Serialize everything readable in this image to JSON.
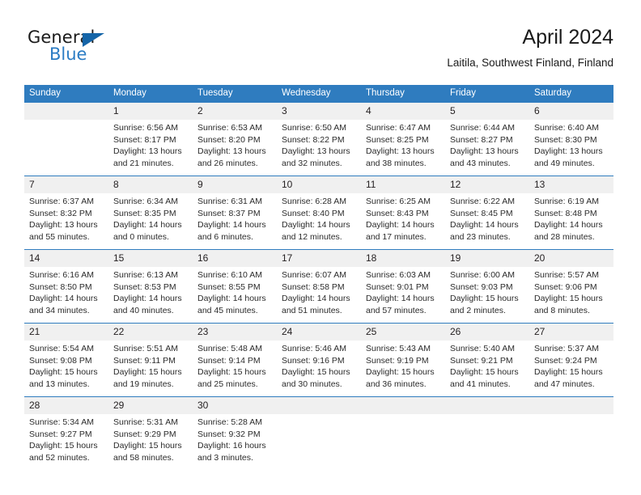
{
  "brand": {
    "name_part1": "General",
    "name_part2": "Blue",
    "triangle_color": "#1565a8",
    "blue_color": "#2b7cc4"
  },
  "header": {
    "title": "April 2024",
    "subtitle": "Laitila, Southwest Finland, Finland"
  },
  "theme": {
    "header_bg": "#2f7cbf",
    "daynum_bg": "#f0f0f0",
    "separator": "#2f7cbf",
    "text": "#231f20"
  },
  "weekday_headers": [
    "Sunday",
    "Monday",
    "Tuesday",
    "Wednesday",
    "Thursday",
    "Friday",
    "Saturday"
  ],
  "labels": {
    "sunrise": "Sunrise:",
    "sunset": "Sunset:",
    "daylight": "Daylight:"
  },
  "weeks": [
    {
      "days": [
        {
          "num": "",
          "empty": true,
          "line1": "",
          "line2": "",
          "line3": "",
          "line4": ""
        },
        {
          "num": "1",
          "empty": false,
          "line1": "Sunrise: 6:56 AM",
          "line2": "Sunset: 8:17 PM",
          "line3": "Daylight: 13 hours",
          "line4": "and 21 minutes."
        },
        {
          "num": "2",
          "empty": false,
          "line1": "Sunrise: 6:53 AM",
          "line2": "Sunset: 8:20 PM",
          "line3": "Daylight: 13 hours",
          "line4": "and 26 minutes."
        },
        {
          "num": "3",
          "empty": false,
          "line1": "Sunrise: 6:50 AM",
          "line2": "Sunset: 8:22 PM",
          "line3": "Daylight: 13 hours",
          "line4": "and 32 minutes."
        },
        {
          "num": "4",
          "empty": false,
          "line1": "Sunrise: 6:47 AM",
          "line2": "Sunset: 8:25 PM",
          "line3": "Daylight: 13 hours",
          "line4": "and 38 minutes."
        },
        {
          "num": "5",
          "empty": false,
          "line1": "Sunrise: 6:44 AM",
          "line2": "Sunset: 8:27 PM",
          "line3": "Daylight: 13 hours",
          "line4": "and 43 minutes."
        },
        {
          "num": "6",
          "empty": false,
          "line1": "Sunrise: 6:40 AM",
          "line2": "Sunset: 8:30 PM",
          "line3": "Daylight: 13 hours",
          "line4": "and 49 minutes."
        }
      ]
    },
    {
      "days": [
        {
          "num": "7",
          "empty": false,
          "line1": "Sunrise: 6:37 AM",
          "line2": "Sunset: 8:32 PM",
          "line3": "Daylight: 13 hours",
          "line4": "and 55 minutes."
        },
        {
          "num": "8",
          "empty": false,
          "line1": "Sunrise: 6:34 AM",
          "line2": "Sunset: 8:35 PM",
          "line3": "Daylight: 14 hours",
          "line4": "and 0 minutes."
        },
        {
          "num": "9",
          "empty": false,
          "line1": "Sunrise: 6:31 AM",
          "line2": "Sunset: 8:37 PM",
          "line3": "Daylight: 14 hours",
          "line4": "and 6 minutes."
        },
        {
          "num": "10",
          "empty": false,
          "line1": "Sunrise: 6:28 AM",
          "line2": "Sunset: 8:40 PM",
          "line3": "Daylight: 14 hours",
          "line4": "and 12 minutes."
        },
        {
          "num": "11",
          "empty": false,
          "line1": "Sunrise: 6:25 AM",
          "line2": "Sunset: 8:43 PM",
          "line3": "Daylight: 14 hours",
          "line4": "and 17 minutes."
        },
        {
          "num": "12",
          "empty": false,
          "line1": "Sunrise: 6:22 AM",
          "line2": "Sunset: 8:45 PM",
          "line3": "Daylight: 14 hours",
          "line4": "and 23 minutes."
        },
        {
          "num": "13",
          "empty": false,
          "line1": "Sunrise: 6:19 AM",
          "line2": "Sunset: 8:48 PM",
          "line3": "Daylight: 14 hours",
          "line4": "and 28 minutes."
        }
      ]
    },
    {
      "days": [
        {
          "num": "14",
          "empty": false,
          "line1": "Sunrise: 6:16 AM",
          "line2": "Sunset: 8:50 PM",
          "line3": "Daylight: 14 hours",
          "line4": "and 34 minutes."
        },
        {
          "num": "15",
          "empty": false,
          "line1": "Sunrise: 6:13 AM",
          "line2": "Sunset: 8:53 PM",
          "line3": "Daylight: 14 hours",
          "line4": "and 40 minutes."
        },
        {
          "num": "16",
          "empty": false,
          "line1": "Sunrise: 6:10 AM",
          "line2": "Sunset: 8:55 PM",
          "line3": "Daylight: 14 hours",
          "line4": "and 45 minutes."
        },
        {
          "num": "17",
          "empty": false,
          "line1": "Sunrise: 6:07 AM",
          "line2": "Sunset: 8:58 PM",
          "line3": "Daylight: 14 hours",
          "line4": "and 51 minutes."
        },
        {
          "num": "18",
          "empty": false,
          "line1": "Sunrise: 6:03 AM",
          "line2": "Sunset: 9:01 PM",
          "line3": "Daylight: 14 hours",
          "line4": "and 57 minutes."
        },
        {
          "num": "19",
          "empty": false,
          "line1": "Sunrise: 6:00 AM",
          "line2": "Sunset: 9:03 PM",
          "line3": "Daylight: 15 hours",
          "line4": "and 2 minutes."
        },
        {
          "num": "20",
          "empty": false,
          "line1": "Sunrise: 5:57 AM",
          "line2": "Sunset: 9:06 PM",
          "line3": "Daylight: 15 hours",
          "line4": "and 8 minutes."
        }
      ]
    },
    {
      "days": [
        {
          "num": "21",
          "empty": false,
          "line1": "Sunrise: 5:54 AM",
          "line2": "Sunset: 9:08 PM",
          "line3": "Daylight: 15 hours",
          "line4": "and 13 minutes."
        },
        {
          "num": "22",
          "empty": false,
          "line1": "Sunrise: 5:51 AM",
          "line2": "Sunset: 9:11 PM",
          "line3": "Daylight: 15 hours",
          "line4": "and 19 minutes."
        },
        {
          "num": "23",
          "empty": false,
          "line1": "Sunrise: 5:48 AM",
          "line2": "Sunset: 9:14 PM",
          "line3": "Daylight: 15 hours",
          "line4": "and 25 minutes."
        },
        {
          "num": "24",
          "empty": false,
          "line1": "Sunrise: 5:46 AM",
          "line2": "Sunset: 9:16 PM",
          "line3": "Daylight: 15 hours",
          "line4": "and 30 minutes."
        },
        {
          "num": "25",
          "empty": false,
          "line1": "Sunrise: 5:43 AM",
          "line2": "Sunset: 9:19 PM",
          "line3": "Daylight: 15 hours",
          "line4": "and 36 minutes."
        },
        {
          "num": "26",
          "empty": false,
          "line1": "Sunrise: 5:40 AM",
          "line2": "Sunset: 9:21 PM",
          "line3": "Daylight: 15 hours",
          "line4": "and 41 minutes."
        },
        {
          "num": "27",
          "empty": false,
          "line1": "Sunrise: 5:37 AM",
          "line2": "Sunset: 9:24 PM",
          "line3": "Daylight: 15 hours",
          "line4": "and 47 minutes."
        }
      ]
    },
    {
      "days": [
        {
          "num": "28",
          "empty": false,
          "line1": "Sunrise: 5:34 AM",
          "line2": "Sunset: 9:27 PM",
          "line3": "Daylight: 15 hours",
          "line4": "and 52 minutes."
        },
        {
          "num": "29",
          "empty": false,
          "line1": "Sunrise: 5:31 AM",
          "line2": "Sunset: 9:29 PM",
          "line3": "Daylight: 15 hours",
          "line4": "and 58 minutes."
        },
        {
          "num": "30",
          "empty": false,
          "line1": "Sunrise: 5:28 AM",
          "line2": "Sunset: 9:32 PM",
          "line3": "Daylight: 16 hours",
          "line4": "and 3 minutes."
        },
        {
          "num": "",
          "empty": true,
          "line1": "",
          "line2": "",
          "line3": "",
          "line4": ""
        },
        {
          "num": "",
          "empty": true,
          "line1": "",
          "line2": "",
          "line3": "",
          "line4": ""
        },
        {
          "num": "",
          "empty": true,
          "line1": "",
          "line2": "",
          "line3": "",
          "line4": ""
        },
        {
          "num": "",
          "empty": true,
          "line1": "",
          "line2": "",
          "line3": "",
          "line4": ""
        }
      ]
    }
  ]
}
